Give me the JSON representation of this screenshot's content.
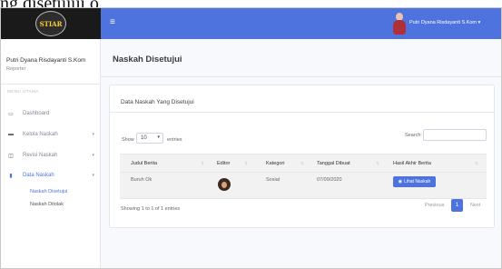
{
  "caption": {
    "left_fragment": "ng disetujui oleh ketua bidang.",
    "right_fragment": ""
  },
  "sidebar": {
    "logo_text": "STIAR",
    "user_name": "Putri Dyana Risdayanti S.Kom",
    "user_role": "Reporter",
    "menu_heading": "MENU UTAMA",
    "items": [
      {
        "label": "Dashboard",
        "icon": "monitor-icon"
      },
      {
        "label": "Kelola Naskah",
        "icon": "inbox-icon"
      },
      {
        "label": "Revisi Naskah",
        "icon": "edit-icon"
      },
      {
        "label": "Data Naskah",
        "icon": "file-icon"
      }
    ],
    "sub_items": [
      {
        "label": "Naskah Disetujui"
      },
      {
        "label": "Naskah Ditolak"
      }
    ]
  },
  "topbar": {
    "menu_icon": "hamburger-icon",
    "user_label": "Putri Dyana Risdayanti S.Kom ▾"
  },
  "main": {
    "page_title": "Naskah Disetujui",
    "card_title": "Data Naskah Yang Disetujui",
    "show_label": "Show",
    "show_value": "10",
    "entries_label": "entries",
    "search_label": "Search:",
    "table": {
      "columns": [
        "Judul Berita",
        "Editor",
        "Kategori",
        "Tanggal Dibuat",
        "Hasil Akhir Berita"
      ],
      "rows": [
        {
          "judul": "Buruh Ok",
          "kategori": "Sosial",
          "tanggal": "07/09/2020",
          "action": "Lihat Naskah"
        }
      ]
    },
    "showing_text": "Showing 1 to 1 of 1 entries",
    "pagination": {
      "previous": "Previous",
      "page": "1",
      "next": "Next"
    }
  },
  "colors": {
    "primary": "#4e73df",
    "sidebar_logo_bg": "#1a1a1a"
  }
}
